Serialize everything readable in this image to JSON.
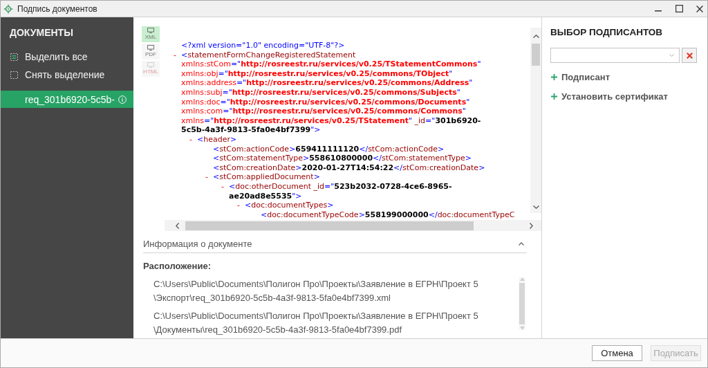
{
  "window": {
    "title": "Подпись документов"
  },
  "sidebar": {
    "title": "ДОКУМЕНТЫ",
    "actions": [
      {
        "kind": "select_all",
        "label": "Выделить все"
      },
      {
        "kind": "deselect_all",
        "label": "Снять выделение"
      }
    ],
    "documents": [
      {
        "name": "req_301b6920-5c5b-",
        "selected": true
      }
    ]
  },
  "xml_view": {
    "tabs": [
      {
        "label": "XML",
        "selected": true,
        "disabled": false
      },
      {
        "label": "PDF",
        "selected": false,
        "disabled": false
      },
      {
        "label": "HTML",
        "selected": false,
        "disabled": true
      }
    ],
    "nodes": [
      {
        "lines": [
          [
            {
              "kind": "markup",
              "text": "<?xml version=\"1.0\" encoding=\"UTF-8\"?>"
            }
          ]
        ]
      },
      {
        "toggle": "-",
        "lines": [
          [
            {
              "kind": "markup",
              "text": "<"
            },
            {
              "kind": "tag",
              "text": "statementFormChangeRegisteredStatement"
            }
          ],
          [
            {
              "kind": "ns_attr",
              "text": "xmlns:stCom"
            },
            {
              "kind": "markup",
              "text": "=\""
            },
            {
              "kind": "ns_value",
              "text": "http://rosreestr.ru/services/v0.25/TStatementCommons"
            },
            {
              "kind": "markup",
              "text": "\""
            }
          ],
          [
            {
              "kind": "ns_attr",
              "text": "xmlns:obj"
            },
            {
              "kind": "markup",
              "text": "=\""
            },
            {
              "kind": "ns_value",
              "text": "http://rosreestr.ru/services/v0.25/commons/TObject"
            },
            {
              "kind": "markup",
              "text": "\""
            }
          ],
          [
            {
              "kind": "ns_attr",
              "text": "xmlns:address"
            },
            {
              "kind": "markup",
              "text": "=\""
            },
            {
              "kind": "ns_value",
              "text": "http://rosreestr.ru/services/v0.25/commons/Address"
            },
            {
              "kind": "markup",
              "text": "\""
            }
          ],
          [
            {
              "kind": "ns_attr",
              "text": "xmlns:subj"
            },
            {
              "kind": "markup",
              "text": "=\""
            },
            {
              "kind": "ns_value",
              "text": "http://rosreestr.ru/services/v0.25/commons/Subjects"
            },
            {
              "kind": "markup",
              "text": "\""
            }
          ],
          [
            {
              "kind": "ns_attr",
              "text": "xmlns:doc"
            },
            {
              "kind": "markup",
              "text": "=\""
            },
            {
              "kind": "ns_value",
              "text": "http://rosreestr.ru/services/v0.25/commons/Documents"
            },
            {
              "kind": "markup",
              "text": "\""
            }
          ],
          [
            {
              "kind": "ns_attr",
              "text": "xmlns:com"
            },
            {
              "kind": "markup",
              "text": "=\""
            },
            {
              "kind": "ns_value",
              "text": "http://rosreestr.ru/services/v0.25/commons/Commons"
            },
            {
              "kind": "markup",
              "text": "\""
            }
          ],
          [
            {
              "kind": "ns_attr",
              "text": "xmlns"
            },
            {
              "kind": "markup",
              "text": "=\""
            },
            {
              "kind": "ns_value",
              "text": "http://rosreestr.ru/services/v0.25/TStatement"
            },
            {
              "kind": "markup",
              "text": "\""
            },
            {
              "kind": "attr",
              "text": " _id"
            },
            {
              "kind": "markup",
              "text": "=\""
            },
            {
              "kind": "value",
              "text": "301b6920-"
            }
          ],
          [
            {
              "kind": "value",
              "text": "5c5b-4a3f-9813-5fa0e4bf7399"
            },
            {
              "kind": "markup",
              "text": "\">"
            }
          ]
        ],
        "children": [
          {
            "toggle": "-",
            "lines": [
              [
                {
                  "kind": "markup",
                  "text": "<"
                },
                {
                  "kind": "tag",
                  "text": "header"
                },
                {
                  "kind": "markup",
                  "text": ">"
                }
              ]
            ],
            "children": [
              {
                "lines": [
                  [
                    {
                      "kind": "markup",
                      "text": "<"
                    },
                    {
                      "kind": "tag",
                      "text": "stCom:actionCode"
                    },
                    {
                      "kind": "markup",
                      "text": ">"
                    },
                    {
                      "kind": "value",
                      "text": "659411111120"
                    },
                    {
                      "kind": "markup",
                      "text": "</"
                    },
                    {
                      "kind": "tag",
                      "text": "stCom:actionCode"
                    },
                    {
                      "kind": "markup",
                      "text": ">"
                    }
                  ]
                ]
              },
              {
                "lines": [
                  [
                    {
                      "kind": "markup",
                      "text": "<"
                    },
                    {
                      "kind": "tag",
                      "text": "stCom:statementType"
                    },
                    {
                      "kind": "markup",
                      "text": ">"
                    },
                    {
                      "kind": "value",
                      "text": "558610800000"
                    },
                    {
                      "kind": "markup",
                      "text": "</"
                    },
                    {
                      "kind": "tag",
                      "text": "stCom:statementType"
                    },
                    {
                      "kind": "markup",
                      "text": ">"
                    }
                  ]
                ]
              },
              {
                "lines": [
                  [
                    {
                      "kind": "markup",
                      "text": "<"
                    },
                    {
                      "kind": "tag",
                      "text": "stCom:creationDate"
                    },
                    {
                      "kind": "markup",
                      "text": ">"
                    },
                    {
                      "kind": "value",
                      "text": "2020-01-27T14:54:22"
                    },
                    {
                      "kind": "markup",
                      "text": "</"
                    },
                    {
                      "kind": "tag",
                      "text": "stCom:creationDate"
                    },
                    {
                      "kind": "markup",
                      "text": ">"
                    }
                  ]
                ]
              },
              {
                "toggle": "-",
                "lines": [
                  [
                    {
                      "kind": "markup",
                      "text": "<"
                    },
                    {
                      "kind": "tag",
                      "text": "stCom:appliedDocument"
                    },
                    {
                      "kind": "markup",
                      "text": ">"
                    }
                  ]
                ],
                "children": [
                  {
                    "toggle": "-",
                    "lines": [
                      [
                        {
                          "kind": "markup",
                          "text": "<"
                        },
                        {
                          "kind": "tag",
                          "text": "doc:otherDocument"
                        },
                        {
                          "kind": "attr",
                          "text": " _id"
                        },
                        {
                          "kind": "markup",
                          "text": "=\""
                        },
                        {
                          "kind": "value",
                          "text": "523b2032-0728-4ce6-8965-"
                        }
                      ],
                      [
                        {
                          "kind": "value",
                          "text": "ae20ad8e5535"
                        },
                        {
                          "kind": "markup",
                          "text": "\">"
                        }
                      ]
                    ],
                    "children": [
                      {
                        "toggle": "-",
                        "lines": [
                          [
                            {
                              "kind": "markup",
                              "text": "<"
                            },
                            {
                              "kind": "tag",
                              "text": "doc:documentTypes"
                            },
                            {
                              "kind": "markup",
                              "text": ">"
                            }
                          ]
                        ],
                        "children": [
                          {
                            "lines": [
                              [
                                {
                                  "kind": "markup",
                                  "text": "<"
                                },
                                {
                                  "kind": "tag",
                                  "text": "doc:documentTypeCode"
                                },
                                {
                                  "kind": "markup",
                                  "text": ">"
                                },
                                {
                                  "kind": "value",
                                  "text": "558199000000"
                                },
                                {
                                  "kind": "markup",
                                  "text": "</"
                                },
                                {
                                  "kind": "tag",
                                  "text": "doc:documentTypeC"
                                }
                              ]
                            ]
                          }
                        ]
                      }
                    ]
                  }
                ]
              }
            ]
          }
        ]
      }
    ]
  },
  "document_info": {
    "title": "Информация о документе",
    "expanded": true,
    "location_label": "Расположение:",
    "paths": [
      "C:\\Users\\Public\\Documents\\Полигон Про\\Проекты\\Заявление в ЕГРН\\Проект 5\n\\Экспорт\\req_301b6920-5c5b-4a3f-9813-5fa0e4bf7399.xml",
      "C:\\Users\\Public\\Documents\\Полигон Про\\Проекты\\Заявление в ЕГРН\\Проект 5\n\\Документы\\req_301b6920-5c5b-4a3f-9813-5fa0e4bf7399.pdf"
    ]
  },
  "signers_panel": {
    "title": "ВЫБОР ПОДПИСАНТОВ",
    "actions": [
      {
        "label": "Подписант"
      },
      {
        "label": "Установить сертификат"
      }
    ]
  },
  "footer": {
    "buttons": [
      {
        "label": "Отмена",
        "disabled": false
      },
      {
        "label": "Подписать",
        "disabled": true
      }
    ]
  }
}
